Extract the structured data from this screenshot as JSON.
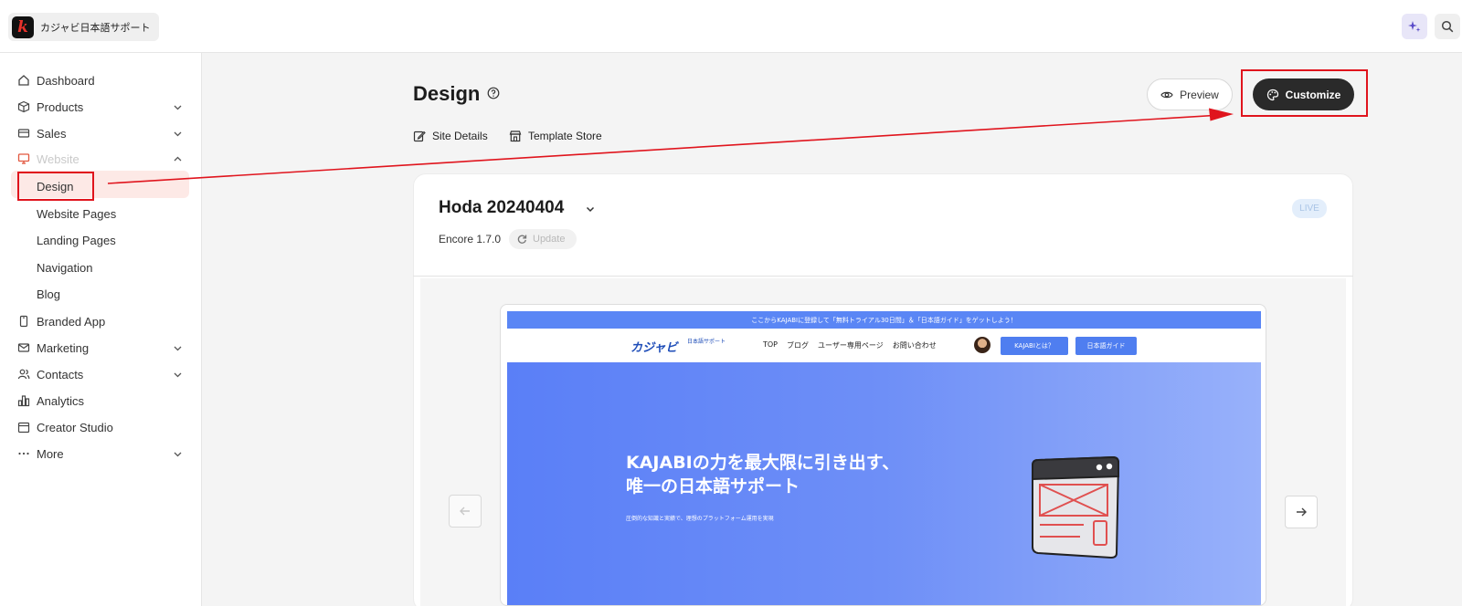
{
  "brand": {
    "name": "カジャビ日本語サポート",
    "logo_letter": "k"
  },
  "sidebar": {
    "items": [
      {
        "label": "Dashboard"
      },
      {
        "label": "Products"
      },
      {
        "label": "Sales"
      },
      {
        "label": "Website"
      },
      {
        "label": "Design"
      },
      {
        "label": "Website Pages"
      },
      {
        "label": "Landing Pages"
      },
      {
        "label": "Navigation"
      },
      {
        "label": "Blog"
      },
      {
        "label": "Branded App"
      },
      {
        "label": "Marketing"
      },
      {
        "label": "Contacts"
      },
      {
        "label": "Analytics"
      },
      {
        "label": "Creator Studio"
      },
      {
        "label": "More"
      }
    ]
  },
  "main": {
    "title": "Design",
    "subnav": {
      "site_details": "Site Details",
      "template_store": "Template Store"
    },
    "preview_label": "Preview",
    "customize_label": "Customize",
    "site": {
      "name": "Hoda 20240404",
      "status": "LIVE",
      "theme_version": "Encore 1.7.0",
      "update_label": "Update"
    },
    "thumbnail": {
      "banner": "ここからKAJABIに登録して「無料トライアル30日間」＆「日本語ガイド」をゲットしよう！",
      "logo": "カジャビ",
      "logo_sub": "日本語サポート",
      "nav_links": [
        "TOP",
        "ブログ",
        "ユーザー専用ページ",
        "お問い合わせ"
      ],
      "button1": "KAJABIとは？",
      "button2": "日本語ガイド",
      "hero_line1": "KAJABIの力を最大限に引き出す、",
      "hero_line2": "唯一の日本語サポート",
      "hero_sub": "圧倒的な知識と実績で、理想のプラットフォーム運用を実現"
    }
  },
  "colors": {
    "accent": "#e0141d",
    "dark_button": "#2a2a2a",
    "thumb_blue": "#5a86f5",
    "active_bg": "#fde9e6"
  }
}
